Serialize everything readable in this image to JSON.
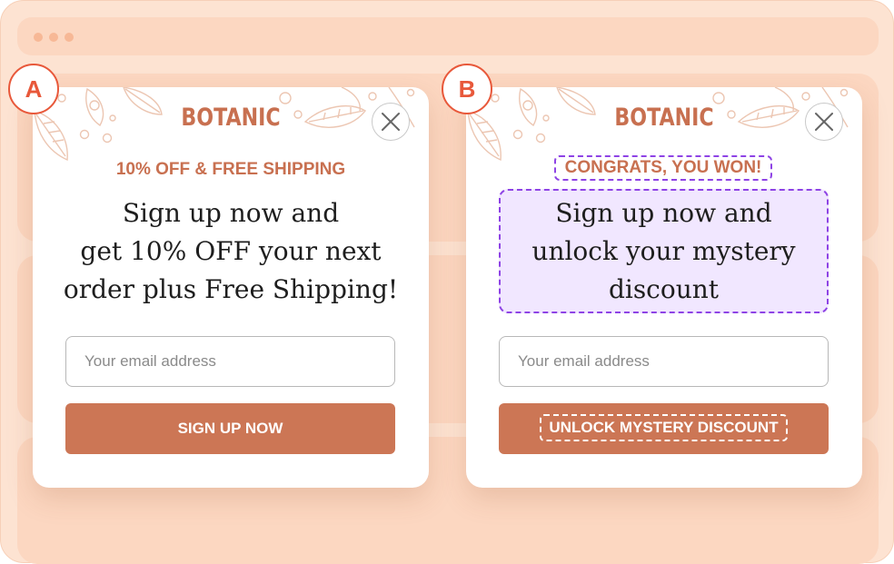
{
  "variant_a": {
    "badge": "A",
    "brand": "BOTANIC",
    "tagline": "10% OFF & FREE SHIPPING",
    "headline_lines": [
      "Sign up now and",
      "get 10% OFF your next",
      "order plus Free Shipping!"
    ],
    "email_placeholder": "Your email address",
    "cta_label": "SIGN UP NOW"
  },
  "variant_b": {
    "badge": "B",
    "brand": "BOTANIC",
    "tagline": "CONGRATS, YOU WON!",
    "headline_lines": [
      "Sign up now and",
      "unlock your mystery",
      "discount"
    ],
    "email_placeholder": "Your email address",
    "cta_label": "UNLOCK MYSTERY DISCOUNT"
  },
  "colors": {
    "brand": "#c87050",
    "cta_background": "#cc7655",
    "highlight_outline": "#8e43e5",
    "highlight_fill": "#f1e7ff",
    "badge": "#e8583a",
    "page_background": "#fde3d2"
  },
  "icons": {
    "close": "close-icon",
    "decoration": "leaf-pattern"
  }
}
